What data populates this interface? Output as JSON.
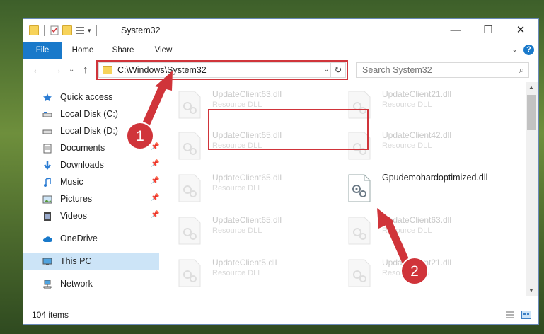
{
  "window": {
    "title": "System32",
    "controls": {
      "minimize": "—",
      "maximize": "☐",
      "close": "✕"
    }
  },
  "ribbon": {
    "tabs": [
      "File",
      "Home",
      "Share",
      "View"
    ],
    "help": "?"
  },
  "navigation": {
    "address_path": "C:\\Windows\\System32",
    "search_placeholder": "Search System32"
  },
  "sidebar": {
    "items": [
      {
        "label": "Quick access",
        "icon": "star-icon"
      },
      {
        "label": "Local Disk (C:)",
        "icon": "drive-icon"
      },
      {
        "label": "Local Disk (D:)",
        "icon": "drive-icon"
      },
      {
        "label": "Documents",
        "icon": "documents-icon"
      },
      {
        "label": "Downloads",
        "icon": "download-icon"
      },
      {
        "label": "Music",
        "icon": "music-icon"
      },
      {
        "label": "Pictures",
        "icon": "pictures-icon"
      },
      {
        "label": "Videos",
        "icon": "videos-icon"
      },
      {
        "label": "OneDrive",
        "icon": "cloud-icon"
      },
      {
        "label": "This PC",
        "icon": "computer-icon"
      },
      {
        "label": "Network",
        "icon": "network-icon"
      }
    ]
  },
  "files": [
    {
      "name": "UpdateClient63.dll",
      "type": "Resource DLL"
    },
    {
      "name": "UpdateClient21.dll",
      "type": "Resource DLL"
    },
    {
      "name": "UpdateClient65.dll",
      "type": "Resource DLL"
    },
    {
      "name": "UpdateClient42.dll",
      "type": "Resource DLL"
    },
    {
      "name": "UpdateClient65.dll",
      "type": "Resource DLL"
    },
    {
      "name": "Gpudemohardoptimized.dll",
      "type": ""
    },
    {
      "name": "UpdateClient65.dll",
      "type": "Resource DLL"
    },
    {
      "name": "UpdateClient63.dll",
      "type": "Resource DLL"
    },
    {
      "name": "UpdateClient5.dll",
      "type": "Resource DLL"
    },
    {
      "name": "UpdateClient21.dll",
      "type": "Resource DLL"
    }
  ],
  "status": {
    "item_count": "104 items"
  },
  "annotations": {
    "step1": "1",
    "step2": "2",
    "accent": "#d0343a"
  }
}
